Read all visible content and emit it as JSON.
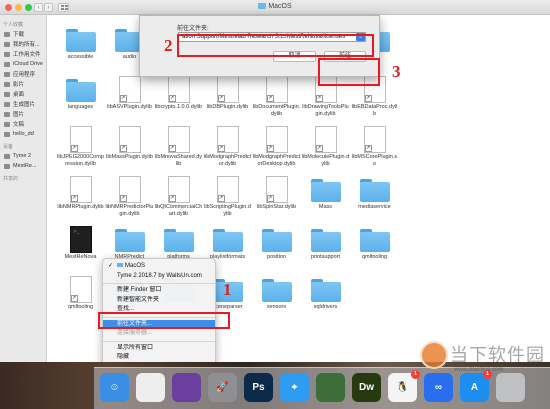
{
  "window": {
    "title": "MacOS",
    "back_glyph": "‹",
    "forward_glyph": "›"
  },
  "sidebar": {
    "sections": [
      {
        "title": "个人收藏",
        "items": [
          {
            "label": "下载",
            "icon": "download-icon"
          },
          {
            "label": "我的所有...",
            "icon": "all-files-icon"
          },
          {
            "label": "工作用文件",
            "icon": "folder-icon"
          },
          {
            "label": "iCloud Drive",
            "icon": "cloud-icon"
          },
          {
            "label": "应用程序",
            "icon": "applications-icon"
          },
          {
            "label": "影片",
            "icon": "movies-icon"
          },
          {
            "label": "桌面",
            "icon": "desktop-icon"
          },
          {
            "label": "生成图片",
            "icon": "folder-icon"
          },
          {
            "label": "图片",
            "icon": "pictures-icon"
          },
          {
            "label": "文稿",
            "icon": "documents-icon"
          },
          {
            "label": "hello_dd",
            "icon": "home-icon"
          }
        ]
      },
      {
        "title": "设备",
        "items": [
          {
            "label": "Tyme 2",
            "icon": "disk-icon"
          },
          {
            "label": "MestRe...",
            "icon": "disk-icon"
          }
        ]
      },
      {
        "title": "共享的",
        "items": []
      }
    ]
  },
  "files": [
    {
      "label": "accessible",
      "type": "folder"
    },
    {
      "label": "audio",
      "type": "folder"
    },
    {
      "label": "bearer",
      "type": "folder"
    },
    {
      "label": "",
      "type": "folder"
    },
    {
      "label": "",
      "type": "folder"
    },
    {
      "label": "",
      "type": "folder"
    },
    {
      "label": "",
      "type": "folder"
    },
    {
      "label": "languages",
      "type": "folder"
    },
    {
      "label": "libASVPlugin.dylib",
      "type": "file"
    },
    {
      "label": "libcrypto.1.0.0.dylib",
      "type": "file"
    },
    {
      "label": "libDBPlugin.dylib",
      "type": "file"
    },
    {
      "label": "libDocumentPlugin.dylib",
      "type": "file"
    },
    {
      "label": "libDrawingToolsPlugin.dylib",
      "type": "file"
    },
    {
      "label": "libEBDataProc.dylib",
      "type": "file"
    },
    {
      "label": "libJPEG2000Compression.dylib",
      "type": "file"
    },
    {
      "label": "libMassPlugin.dylib",
      "type": "file"
    },
    {
      "label": "libMnovaShared.dylib",
      "type": "file"
    },
    {
      "label": "libModgraphPredictor.dylib",
      "type": "file"
    },
    {
      "label": "libModgraphPredictorDesktop.dylib",
      "type": "file"
    },
    {
      "label": "libMoleculePlugin.dylib",
      "type": "file"
    },
    {
      "label": "libMSCorePlugin.so",
      "type": "file"
    },
    {
      "label": "libNMRPlugin.dylib",
      "type": "file"
    },
    {
      "label": "libNMRPredictorPlugin.dylib",
      "type": "file"
    },
    {
      "label": "libQtCommercialChart.dylib",
      "type": "file"
    },
    {
      "label": "libScriptingPlugin.dylib",
      "type": "file"
    },
    {
      "label": "libSpinStar.dylib",
      "type": "file"
    },
    {
      "label": "Mass",
      "type": "folder"
    },
    {
      "label": "mediaservice",
      "type": "folder"
    },
    {
      "label": "MestReNova",
      "type": "exec"
    },
    {
      "label": "NMRPredict",
      "type": "folder"
    },
    {
      "label": "platforms",
      "type": "folder"
    },
    {
      "label": "playlistformats",
      "type": "folder"
    },
    {
      "label": "position",
      "type": "folder"
    },
    {
      "label": "printsupport",
      "type": "folder"
    },
    {
      "label": "qmltooling",
      "type": "folder"
    },
    {
      "label": "qmltooling",
      "type": "file"
    },
    {
      "label": "",
      "type": "folder"
    },
    {
      "label": "",
      "type": "folder"
    },
    {
      "label": "sceneparser",
      "type": "folder"
    },
    {
      "label": "sensors",
      "type": "folder"
    },
    {
      "label": "sqldrivers",
      "type": "folder"
    }
  ],
  "dialog": {
    "label": "前往文件夹:",
    "path_value": "ation Support/Mestrelab Research S.L./MestReNova/licenses",
    "combo_glyph": "⌄",
    "cancel": "取消",
    "go": "前往"
  },
  "context_menu": {
    "items": [
      {
        "label": "MacOS",
        "kind": "check",
        "icon": "folder-icon"
      },
      {
        "label": "Tyme 2  2018.7 by WaitsUn.com",
        "kind": "normal"
      },
      {
        "label": "",
        "kind": "sep"
      },
      {
        "label": "新建 Finder 窗口",
        "kind": "normal"
      },
      {
        "label": "新建智能文件夹",
        "kind": "normal"
      },
      {
        "label": "查找...",
        "kind": "normal"
      },
      {
        "label": "",
        "kind": "sep"
      },
      {
        "label": "前往文件夹...",
        "kind": "highlight"
      },
      {
        "label": "连接服务器...",
        "kind": "dim"
      },
      {
        "label": "",
        "kind": "sep"
      },
      {
        "label": "显示所有窗口",
        "kind": "normal"
      },
      {
        "label": "隐藏",
        "kind": "normal"
      }
    ]
  },
  "annotations": {
    "n1": "1",
    "n2": "2",
    "n3": "3",
    "color": "#e31b23"
  },
  "dock": {
    "apps": [
      {
        "name": "Finder",
        "icon": "finder-icon",
        "glyph": "☺",
        "color": "#3b8ee6"
      },
      {
        "name": "",
        "icon": "notes-icon",
        "glyph": "",
        "color": "#eeeeee"
      },
      {
        "name": "",
        "icon": "photo-icon",
        "glyph": "",
        "color": "#6a3fa0"
      },
      {
        "name": "",
        "icon": "rocket-icon",
        "glyph": "🚀",
        "color": "#8e8e93"
      },
      {
        "name": "Ps",
        "icon": "photoshop-icon",
        "glyph": "Ps",
        "color": "#0b2a4a"
      },
      {
        "name": "",
        "icon": "safari-icon",
        "glyph": "⌖",
        "color": "#2d9bf0"
      },
      {
        "name": "",
        "icon": "mosaic-icon",
        "glyph": "",
        "color": "#3d6e3a"
      },
      {
        "name": "Dw",
        "icon": "dreamweaver-icon",
        "glyph": "Dw",
        "color": "#26390f"
      },
      {
        "name": "",
        "icon": "qq-icon",
        "glyph": "🐧",
        "color": "#f4f4f4",
        "badge": "1"
      },
      {
        "name": "",
        "icon": "baidu-icon",
        "glyph": "∞",
        "color": "#2a6ef0"
      },
      {
        "name": "",
        "icon": "appstore-icon",
        "glyph": "A",
        "color": "#1c8ef0",
        "badge": "1"
      },
      {
        "name": "",
        "icon": "trash-icon",
        "glyph": "",
        "color": "#bfc0c4"
      }
    ]
  },
  "watermark": {
    "title": "当下软件园",
    "url": "www.downxia.com"
  }
}
